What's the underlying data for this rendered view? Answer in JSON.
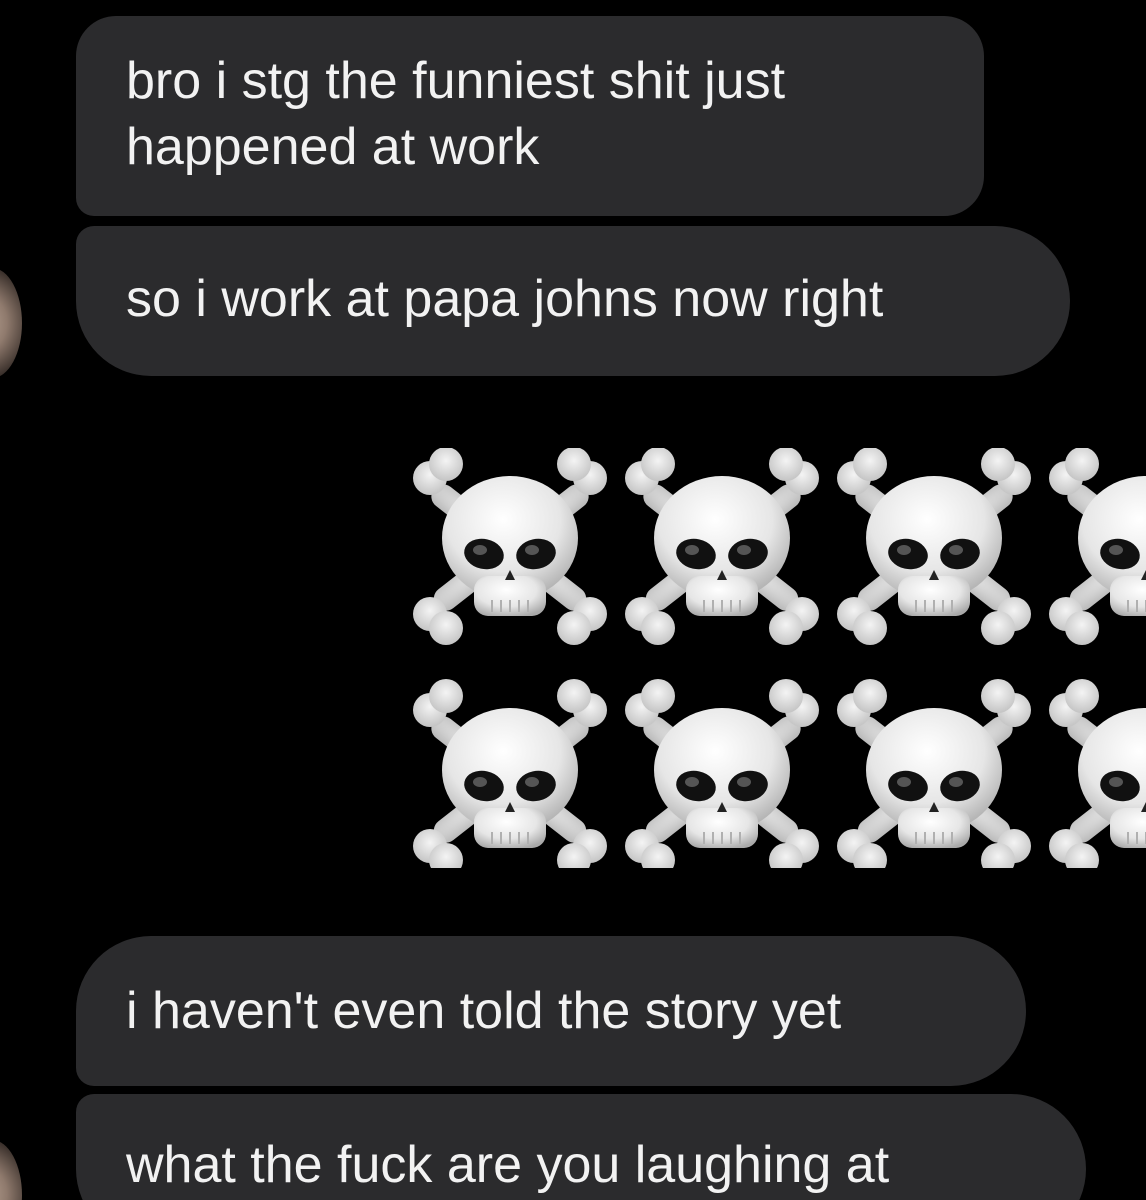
{
  "messages": [
    {
      "lines": [
        "bro i stg the funniest shit just",
        "happened at work"
      ]
    },
    {
      "lines": [
        "so i work at papa johns now right"
      ]
    },
    {
      "emoji": "skull-and-crossbones",
      "rows": 2,
      "per_row_visible": 4
    },
    {
      "lines": [
        "i haven't even told the story yet"
      ]
    },
    {
      "lines": [
        "what the fuck are you laughing at"
      ]
    }
  ],
  "colors": {
    "background": "#000000",
    "bubble": "#2b2b2d",
    "text": "#f2f2f2"
  }
}
